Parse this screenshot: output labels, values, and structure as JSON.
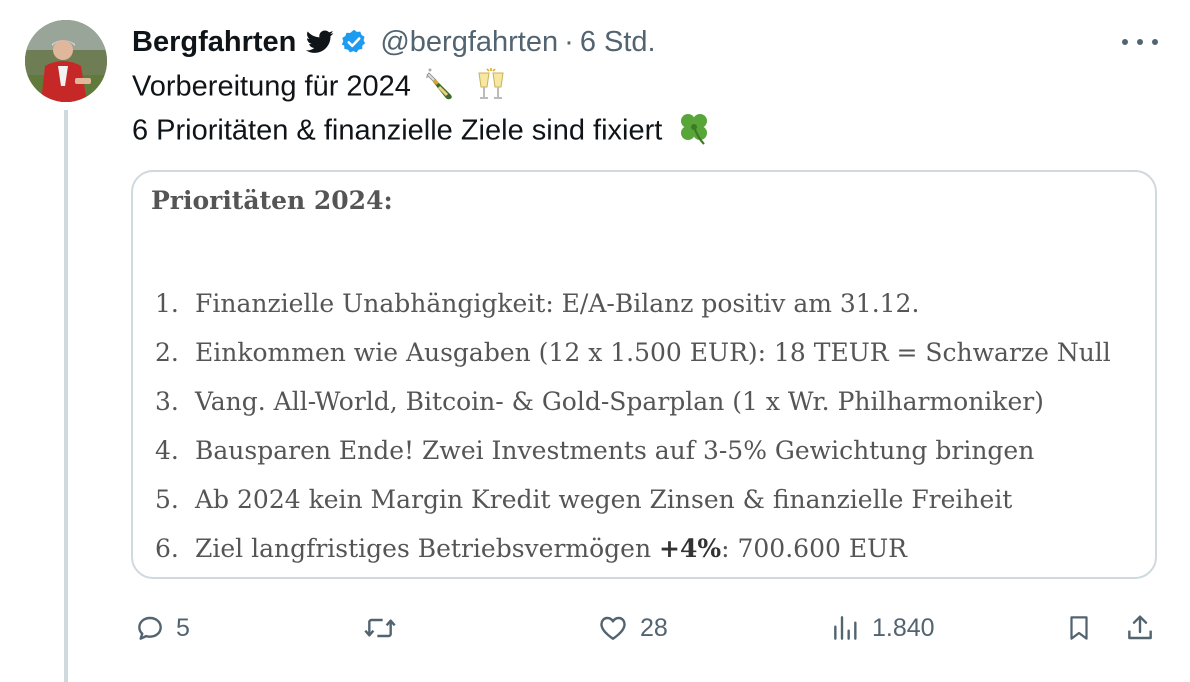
{
  "tweet": {
    "author_name": "Bergfahrten",
    "handle": "@bergfahrten",
    "separator": "·",
    "time": "6 Std.",
    "line1": "Vorbereitung für 2024",
    "line2": "6 Prioritäten & finanzielle Ziele sind fixiert",
    "icons": {
      "bird": "twitter-bird-icon",
      "verified": "verified-badge-icon",
      "champagne": "champagne-bottle-emoji",
      "glasses": "clinking-glasses-emoji",
      "clover": "four-leaf-clover-emoji",
      "more": "more-options-icon"
    }
  },
  "card": {
    "title": "Prioritäten 2024:",
    "items": [
      {
        "num": "1.",
        "text": "Finanzielle Unabhängigkeit: E/A-Bilanz positiv am 31.12."
      },
      {
        "num": "2.",
        "text": "Einkommen wie Ausgaben (12 x 1.500 EUR): 18 TEUR = Schwarze Null"
      },
      {
        "num": "3.",
        "text": "Vang. All-World, Bitcoin- & Gold-Sparplan (1 x Wr. Philharmoniker)"
      },
      {
        "num": "4.",
        "text": "Bausparen Ende! Zwei Investments auf 3-5% Gewichtung bringen"
      },
      {
        "num": "5.",
        "text": "Ab 2024 kein Margin Kredit wegen Zinsen & finanzielle Freiheit"
      },
      {
        "num": "6.",
        "text_before": "Ziel langfristiges Betriebsvermögen ",
        "text_bold": "+4%",
        "text_after": ": 700.600 EUR"
      }
    ]
  },
  "actions": {
    "reply_count": "5",
    "like_count": "28",
    "views_count": "1.840",
    "colors": {
      "muted": "#536471",
      "verified": "#1d9bf0"
    }
  }
}
